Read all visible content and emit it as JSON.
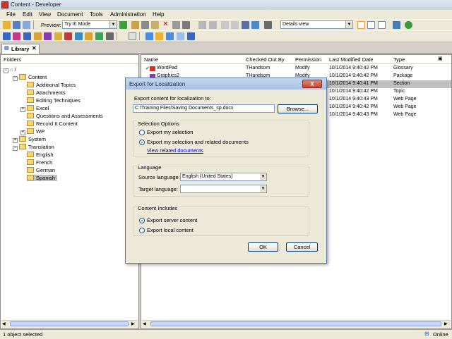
{
  "window": {
    "title": "Content - Developer"
  },
  "menu": [
    "File",
    "Edit",
    "View",
    "Document",
    "Tools",
    "Administration",
    "Help"
  ],
  "toolbar": {
    "preview_label": "Preview:",
    "preview_mode": "Try It! Mode",
    "view_mode": "Details view"
  },
  "tab": {
    "label": "Library",
    "close": "✕"
  },
  "folders": {
    "header": "Folders",
    "items": [
      {
        "label": "/"
      },
      {
        "label": "Content"
      },
      {
        "label": "Additional Topics"
      },
      {
        "label": "Attachments"
      },
      {
        "label": "Editing Techniques"
      },
      {
        "label": "Excel"
      },
      {
        "label": "Questions and Assessments"
      },
      {
        "label": "Record It Content"
      },
      {
        "label": "WP"
      },
      {
        "label": "System"
      },
      {
        "label": "Translation"
      },
      {
        "label": "English"
      },
      {
        "label": "French"
      },
      {
        "label": "German"
      },
      {
        "label": "Spanish"
      }
    ]
  },
  "list": {
    "columns": [
      "Name",
      "Checked Out By",
      "Permission",
      "Last Modified Date",
      "Type"
    ],
    "rows": [
      {
        "name": "WordPad",
        "checked_out_by": "THandsom",
        "permission": "Modify",
        "modified": "10/1/2014 9:40:42 PM",
        "type": "Glossary"
      },
      {
        "name": "Graphics2",
        "checked_out_by": "THandsom",
        "permission": "Modify",
        "modified": "10/1/2014 9:40:42 PM",
        "type": "Package"
      },
      {
        "name": "",
        "checked_out_by": "",
        "permission": "",
        "modified": "10/1/2014 9:40:41 PM",
        "type": "Section"
      },
      {
        "name": "",
        "checked_out_by": "",
        "permission": "",
        "modified": "10/1/2014 9:40:42 PM",
        "type": "Topic"
      },
      {
        "name": "",
        "checked_out_by": "",
        "permission": "",
        "modified": "10/1/2014 9:40:43 PM",
        "type": "Web Page"
      },
      {
        "name": "",
        "checked_out_by": "",
        "permission": "",
        "modified": "10/1/2014 9:40:42 PM",
        "type": "Web Page"
      },
      {
        "name": "",
        "checked_out_by": "",
        "permission": "",
        "modified": "10/1/2014 9:40:43 PM",
        "type": "Web Page"
      }
    ]
  },
  "status": {
    "left": "1 object selected",
    "right": "Online"
  },
  "dialog": {
    "title": "Export for Localization",
    "close": "X",
    "export_label": "Export content for localization to:",
    "export_path": "C:\\Training Files\\Saving Documents_sp.docx",
    "browse": "Browse...",
    "selection_options": "Selection Options",
    "opt_export_selection": "Export my selection",
    "opt_export_related": "Export my selection and related documents",
    "view_related": "View related documents",
    "language": "Language",
    "source_label": "Source language:",
    "source_value": "English (United States)",
    "target_label": "Target language:",
    "target_value": "",
    "content_includes": "Content Includes",
    "opt_server": "Export server content",
    "opt_local": "Export local content",
    "ok": "OK",
    "cancel": "Cancel"
  },
  "colors": {
    "title_bg": "#c6d4e4",
    "dialog_title": "#a6c0e4",
    "selected_row": "#c0c0c0",
    "link": "#0000cc"
  }
}
